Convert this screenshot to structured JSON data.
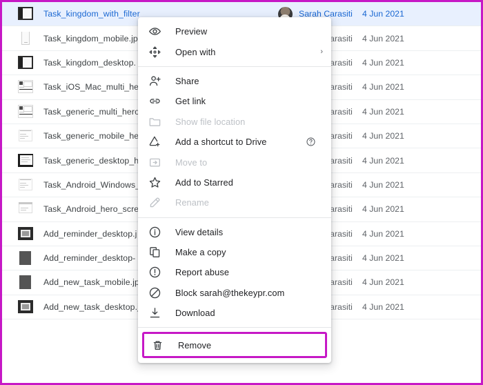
{
  "app": {
    "name": "Google Drive file list with right-click context menu"
  },
  "theme": {
    "accent_highlight": "#c618c6",
    "row_selected_bg": "#e8f0fe",
    "row_selected_text": "#1967d2",
    "menu_text": "#202124",
    "menu_disabled_text": "#bdc1c6"
  },
  "files": [
    {
      "name": "Task_kingdom_with_filter",
      "owner": "Sarah Carasiti",
      "modified": "4 Jun 2021",
      "selected": true,
      "shared": false,
      "thumb": "screenshot-dark-sidebar"
    },
    {
      "name": "Task_kingdom_mobile.jpg",
      "owner": "Sarah Carasiti",
      "modified": "4 Jun 2021",
      "selected": false,
      "shared": false,
      "thumb": "screenshot-mobile-light"
    },
    {
      "name": "Task_kingdom_desktop.",
      "owner": "Sarah Carasiti",
      "modified": "4 Jun 2021",
      "selected": false,
      "shared": false,
      "thumb": "screenshot-dark-sidebar"
    },
    {
      "name": "Task_iOS_Mac_multi_he",
      "owner": "Sarah Carasiti",
      "modified": "4 Jun 2021",
      "selected": false,
      "shared": false,
      "thumb": "screenshot-multi-light"
    },
    {
      "name": "Task_generic_multi_hero",
      "owner": "Sarah Carasiti",
      "modified": "4 Jun 2021",
      "selected": false,
      "shared": false,
      "thumb": "screenshot-multi-light"
    },
    {
      "name": "Task_generic_mobile_he",
      "owner": "Sarah Carasiti",
      "modified": "4 Jun 2021",
      "selected": false,
      "shared": false,
      "thumb": "screenshot-faint"
    },
    {
      "name": "Task_generic_desktop_h",
      "owner": "Sarah Carasiti",
      "modified": "4 Jun 2021",
      "selected": false,
      "shared": false,
      "thumb": "screenshot-dark-frame"
    },
    {
      "name": "Task_Android_Windows_",
      "owner": "Sarah Carasiti",
      "modified": "4 Jun 2021",
      "selected": false,
      "shared": false,
      "thumb": "screenshot-faint"
    },
    {
      "name": "Task_Android_hero_scre",
      "owner": "Sarah Carasiti",
      "modified": "4 Jun 2021",
      "selected": false,
      "shared": false,
      "thumb": "screenshot-faint-top"
    },
    {
      "name": "Add_reminder_desktop.j",
      "owner": "Sarah Carasiti",
      "modified": "4 Jun 2021",
      "selected": false,
      "shared": false,
      "thumb": "screenshot-dark-window"
    },
    {
      "name": "Add_reminder_desktop-",
      "owner": "Sarah Carasiti",
      "modified": "4 Jun 2021",
      "selected": false,
      "shared": false,
      "thumb": "screenshot-solid-grey"
    },
    {
      "name": "Add_new_task_mobile.jp",
      "owner": "Sarah Carasiti",
      "modified": "4 Jun 2021",
      "selected": false,
      "shared": false,
      "thumb": "screenshot-solid-grey"
    },
    {
      "name": "Add_new_task_desktop.jpg",
      "owner": "Sarah Carasiti",
      "modified": "4 Jun 2021",
      "selected": false,
      "shared": true,
      "thumb": "screenshot-dark-window"
    }
  ],
  "shared_badge_glyph": "‥‥",
  "context_menu": {
    "groups": [
      {
        "items": [
          {
            "label": "Preview",
            "icon": "eye-icon",
            "disabled": false,
            "submenu": false,
            "help": false
          },
          {
            "label": "Open with",
            "icon": "open-with-icon",
            "disabled": false,
            "submenu": true,
            "help": false
          }
        ]
      },
      {
        "items": [
          {
            "label": "Share",
            "icon": "person-add-icon",
            "disabled": false,
            "submenu": false,
            "help": false
          },
          {
            "label": "Get link",
            "icon": "link-icon",
            "disabled": false,
            "submenu": false,
            "help": false
          },
          {
            "label": "Show file location",
            "icon": "folder-icon",
            "disabled": true,
            "submenu": false,
            "help": false
          },
          {
            "label": "Add a shortcut to Drive",
            "icon": "shortcut-icon",
            "disabled": false,
            "submenu": false,
            "help": true
          },
          {
            "label": "Move to",
            "icon": "move-to-icon",
            "disabled": true,
            "submenu": false,
            "help": false
          },
          {
            "label": "Add to Starred",
            "icon": "star-icon",
            "disabled": false,
            "submenu": false,
            "help": false
          },
          {
            "label": "Rename",
            "icon": "pencil-icon",
            "disabled": true,
            "submenu": false,
            "help": false
          }
        ]
      },
      {
        "items": [
          {
            "label": "View details",
            "icon": "info-icon",
            "disabled": false,
            "submenu": false,
            "help": false
          },
          {
            "label": "Make a copy",
            "icon": "copy-icon",
            "disabled": false,
            "submenu": false,
            "help": false
          },
          {
            "label": "Report abuse",
            "icon": "warning-icon",
            "disabled": false,
            "submenu": false,
            "help": false
          },
          {
            "label": "Block sarah@thekeypr.com",
            "icon": "block-icon",
            "disabled": false,
            "submenu": false,
            "help": false
          },
          {
            "label": "Download",
            "icon": "download-icon",
            "disabled": false,
            "submenu": false,
            "help": false
          }
        ]
      }
    ],
    "remove_item": {
      "label": "Remove",
      "icon": "trash-icon",
      "highlighted": true
    }
  }
}
